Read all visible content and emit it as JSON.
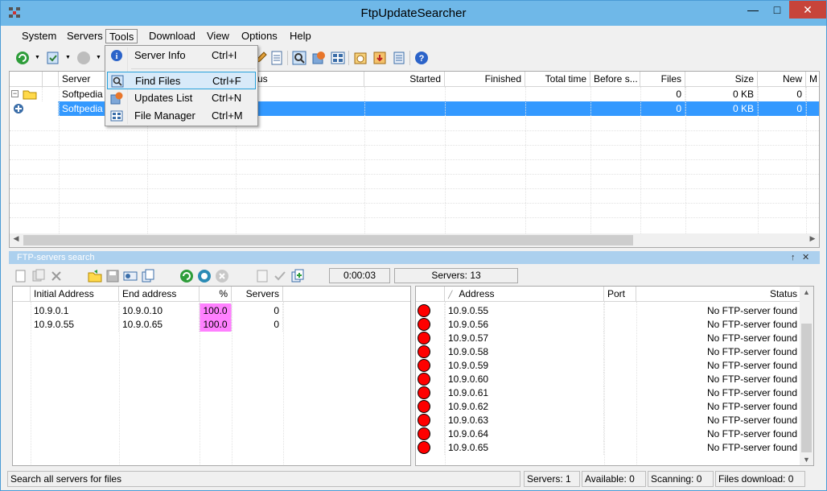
{
  "window": {
    "title": "FtpUpdateSearcher",
    "minimize": "—",
    "maximize": "□",
    "close": "✕"
  },
  "menu": {
    "items": [
      "System",
      "Servers",
      "Tools",
      "Download",
      "View",
      "Options",
      "Help"
    ]
  },
  "tools_menu": {
    "items": [
      {
        "label": "Server Info",
        "shortcut": "Ctrl+I",
        "icon": "info-icon"
      },
      {
        "label": "Find Files",
        "shortcut": "Ctrl+F",
        "icon": "find-files-icon"
      },
      {
        "label": "Updates List",
        "shortcut": "Ctrl+N",
        "icon": "updates-list-icon"
      },
      {
        "label": "File Manager",
        "shortcut": "Ctrl+M",
        "icon": "file-manager-icon"
      }
    ]
  },
  "servers_grid": {
    "columns": [
      "",
      "Server",
      "",
      "Status",
      "Started",
      "Finished",
      "Total time",
      "Before s...",
      "Files",
      "Size",
      "New",
      "M"
    ],
    "rows": [
      {
        "server": "Softpedia",
        "files": "0",
        "size": "0 KB",
        "new": "0"
      },
      {
        "server": "Softpedia",
        "files": "0",
        "size": "0 KB",
        "new": "0"
      }
    ],
    "status_header_fragment": "us"
  },
  "ftp_panel": {
    "title": "FTP-servers search",
    "pin": "↑",
    "close": "✕",
    "timer": "0:00:03",
    "servers_count": "Servers: 13",
    "ranges_columns": [
      "Initial Address",
      "End address",
      "%",
      "Servers"
    ],
    "ranges": [
      {
        "initial": "10.9.0.1",
        "end": "10.9.0.10",
        "percent": "100.0",
        "servers": "0"
      },
      {
        "initial": "10.9.0.55",
        "end": "10.9.0.65",
        "percent": "100.0",
        "servers": "0"
      }
    ],
    "results_columns": [
      "Address",
      "Port",
      "Status"
    ],
    "sort_glyph": "╱",
    "results": [
      {
        "address": "10.9.0.55",
        "status": "No FTP-server found"
      },
      {
        "address": "10.9.0.56",
        "status": "No FTP-server found"
      },
      {
        "address": "10.9.0.57",
        "status": "No FTP-server found"
      },
      {
        "address": "10.9.0.58",
        "status": "No FTP-server found"
      },
      {
        "address": "10.9.0.59",
        "status": "No FTP-server found"
      },
      {
        "address": "10.9.0.60",
        "status": "No FTP-server found"
      },
      {
        "address": "10.9.0.61",
        "status": "No FTP-server found"
      },
      {
        "address": "10.9.0.62",
        "status": "No FTP-server found"
      },
      {
        "address": "10.9.0.63",
        "status": "No FTP-server found"
      },
      {
        "address": "10.9.0.64",
        "status": "No FTP-server found"
      },
      {
        "address": "10.9.0.65",
        "status": "No FTP-server found"
      }
    ]
  },
  "status": {
    "hint": "Search all servers for files",
    "servers": "Servers: 1",
    "available": "Available: 0",
    "scanning": "Scanning: 0",
    "files_download": "Files download: 0"
  },
  "colors": {
    "selection": "#3399ff",
    "percent_fill": "#ff80ff",
    "status_dot": "#ff0000",
    "titlebar": "#6fb8e8"
  }
}
